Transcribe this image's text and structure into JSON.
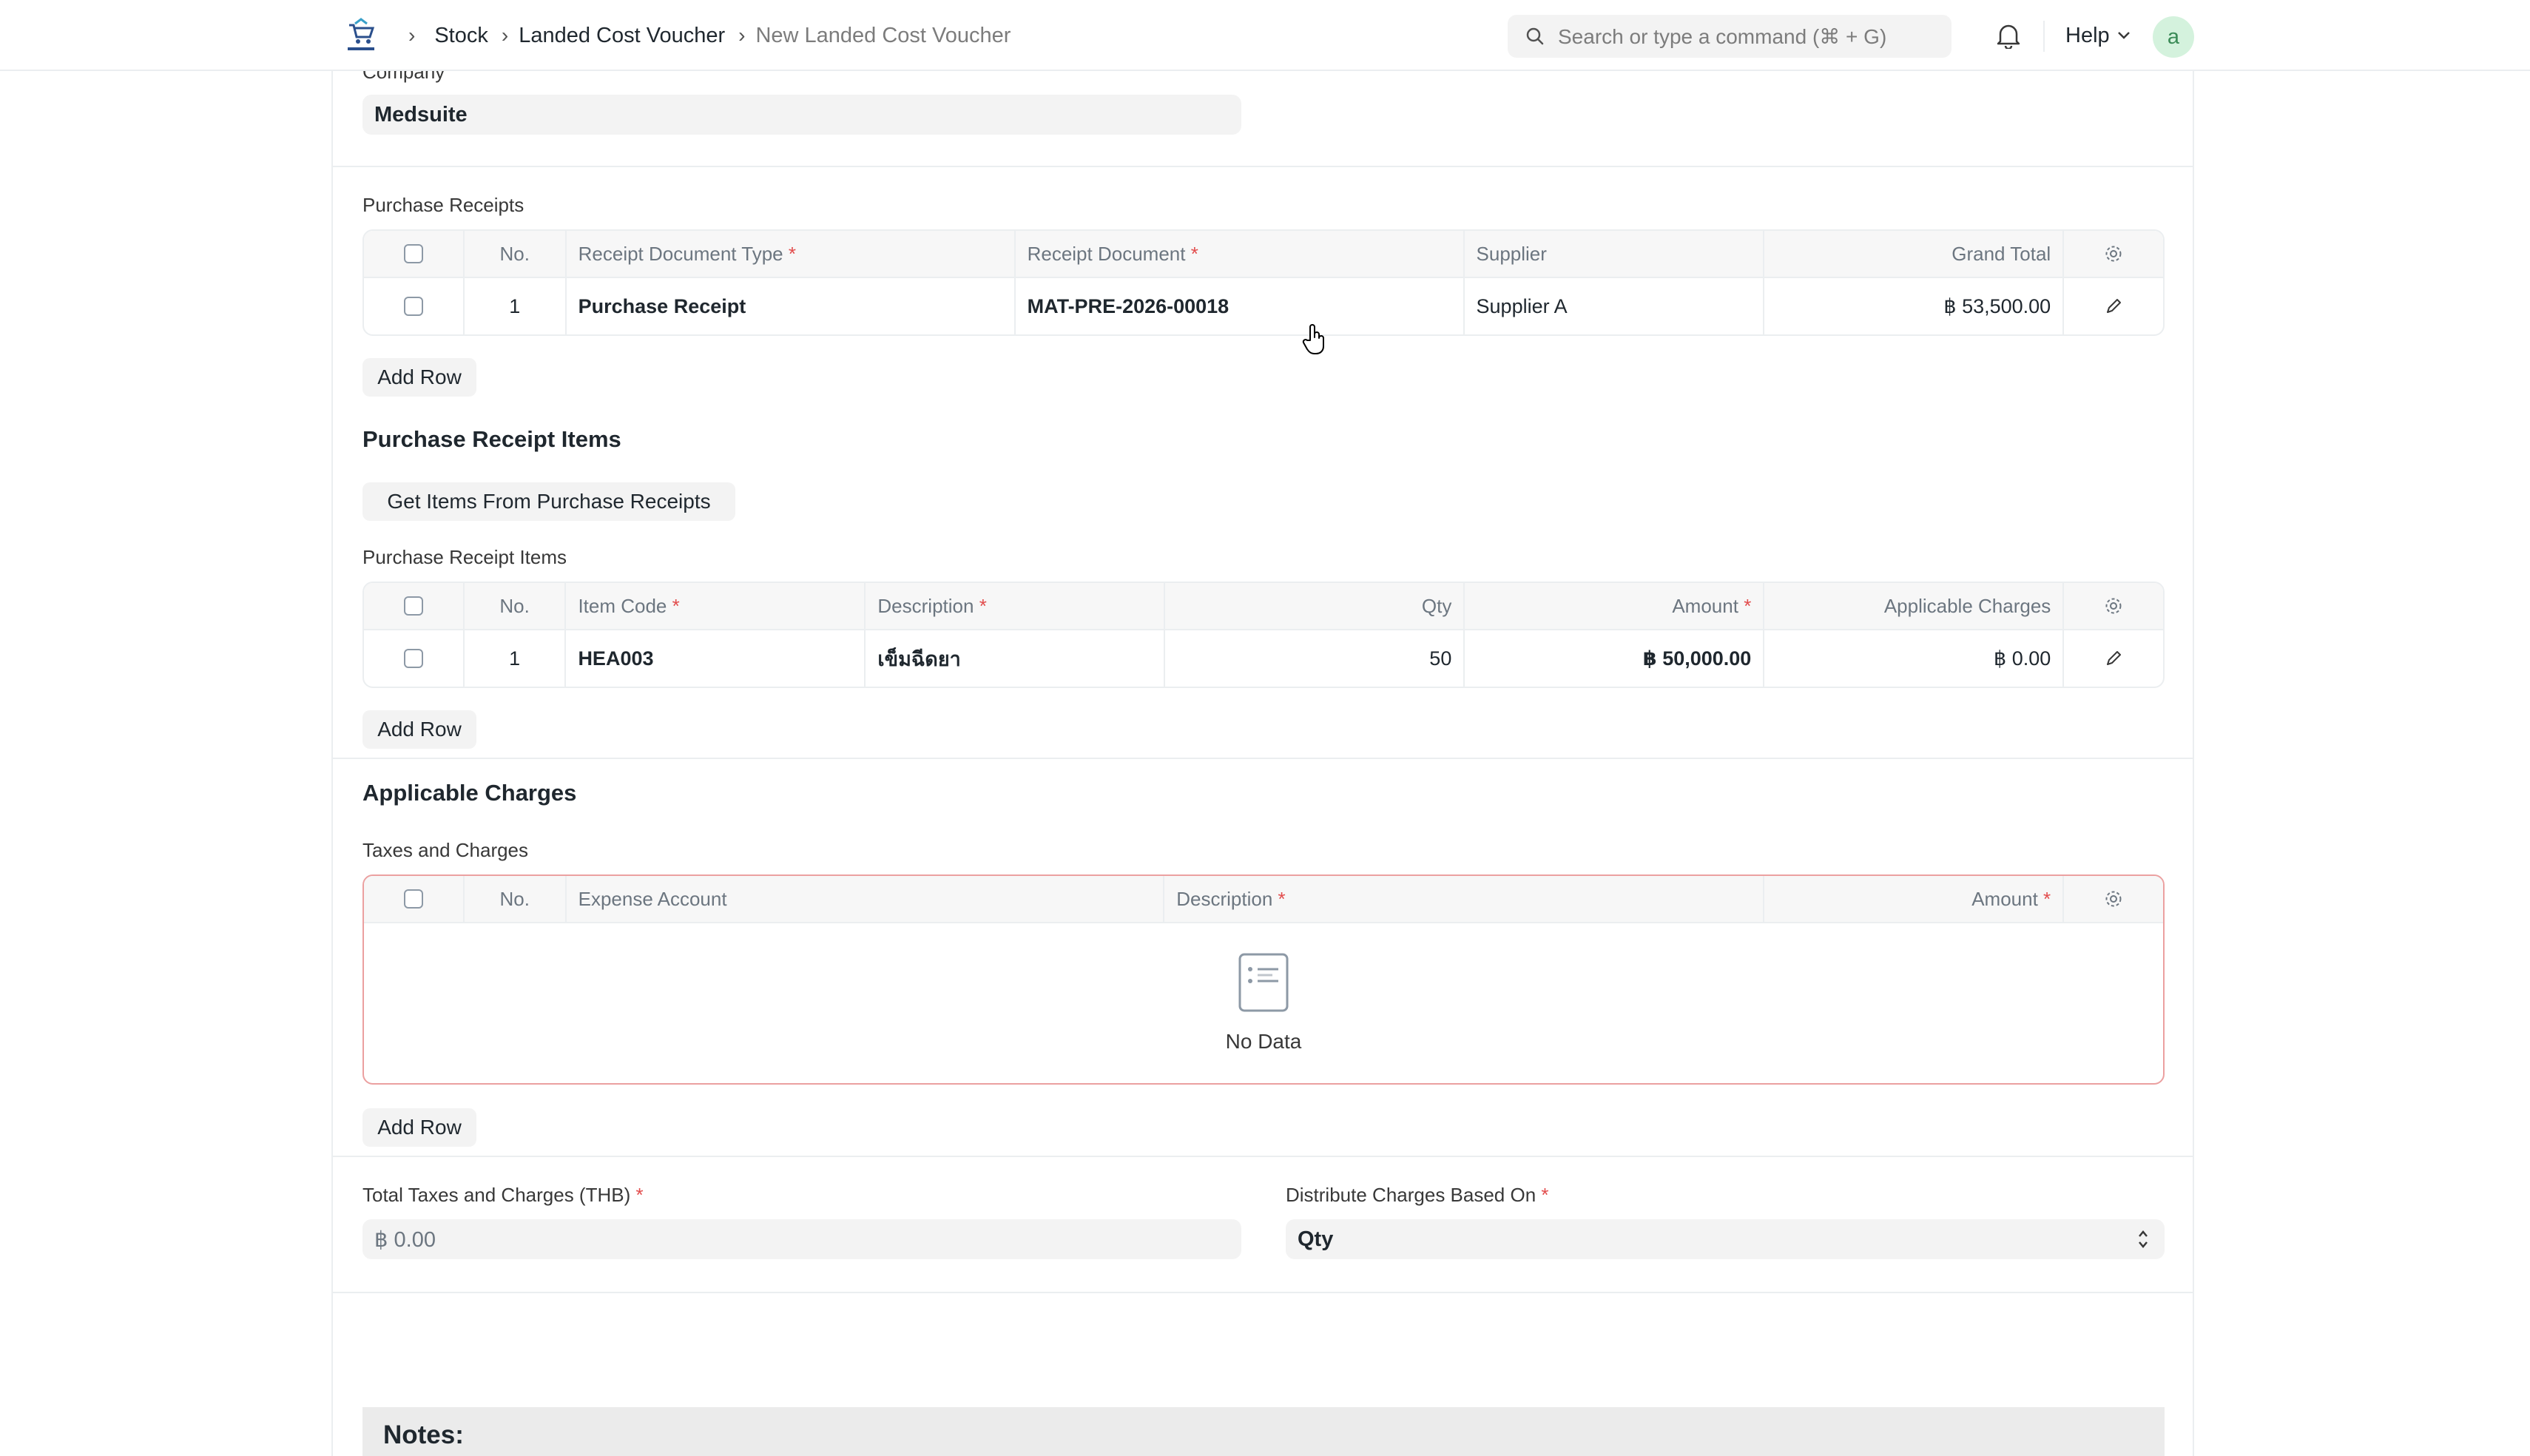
{
  "breadcrumb": {
    "items": [
      "Stock",
      "Landed Cost Voucher"
    ],
    "current": "New Landed Cost Voucher"
  },
  "search": {
    "placeholder": "Search or type a command (⌘ + G)"
  },
  "nav": {
    "help": "Help",
    "avatar_initial": "a"
  },
  "company": {
    "label": "Company",
    "value": "Medsuite"
  },
  "purchase_receipts": {
    "label": "Purchase Receipts",
    "columns": [
      "No.",
      "Receipt Document Type",
      "Receipt Document",
      "Supplier",
      "Grand Total"
    ],
    "rows": [
      {
        "no": "1",
        "doc_type": "Purchase Receipt",
        "doc": "MAT-PRE-2026-00018",
        "supplier": "Supplier A",
        "grand_total": "฿ 53,500.00"
      }
    ],
    "add_row": "Add Row"
  },
  "receipt_items_section": {
    "title": "Purchase Receipt Items",
    "get_items_button": "Get Items From Purchase Receipts",
    "table_label": "Purchase Receipt Items",
    "columns": [
      "No.",
      "Item Code",
      "Description",
      "Qty",
      "Amount",
      "Applicable Charges"
    ],
    "rows": [
      {
        "no": "1",
        "item_code": "HEA003",
        "description": "เข็มฉีดยา",
        "qty": "50",
        "amount": "฿ 50,000.00",
        "charges": "฿ 0.00"
      }
    ],
    "add_row": "Add Row"
  },
  "charges_section": {
    "title": "Applicable Charges",
    "table_label": "Taxes and Charges",
    "columns": [
      "No.",
      "Expense Account",
      "Description",
      "Amount"
    ],
    "empty_text": "No Data",
    "add_row": "Add Row"
  },
  "totals": {
    "total_label": "Total Taxes and Charges (THB)",
    "total_value": "฿ 0.00",
    "distribute_label": "Distribute Charges Based On",
    "distribute_value": "Qty"
  },
  "notes": {
    "title": "Notes:"
  },
  "colors": {
    "required": "#e24c4c",
    "error_border": "#eba0a0",
    "field_bg": "#f3f3f3"
  },
  "icons": [
    "logo-icon",
    "search-icon",
    "bell-icon",
    "chevron-down-icon",
    "settings-gear-icon",
    "edit-pencil-icon",
    "no-data-icon",
    "select-arrows-icon",
    "hand-cursor-icon"
  ]
}
